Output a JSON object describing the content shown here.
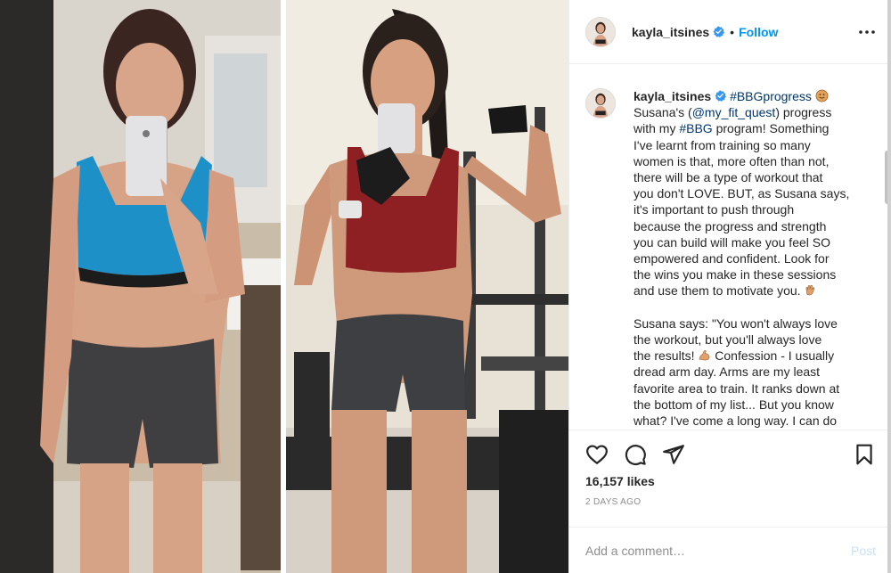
{
  "post": {
    "username": "kayla_itsines",
    "follow_label": "Follow",
    "separator": "•",
    "caption_segments": [
      {
        "kind": "tag",
        "text": "#BBGprogress"
      },
      {
        "kind": "text",
        "text": " "
      },
      {
        "kind": "emoji",
        "text": "🤗"
      },
      {
        "kind": "text",
        "text": "\nSusana's ("
      },
      {
        "kind": "tag",
        "text": "@my_fit_quest"
      },
      {
        "kind": "text",
        "text": ") progress\nwith my "
      },
      {
        "kind": "tag",
        "text": "#BBG"
      },
      {
        "kind": "text",
        "text": " program! Something\nI've learnt from training so many\nwomen is that, more often than not,\nthere will be a type of workout that\nyou don't LOVE. BUT, as Susana says,\nit's important to push through\nbecause the progress and strength\nyou can build will make you feel SO\nempowered and confident. Look for\nthe wins you make in these sessions\nand use them to motivate you. "
      },
      {
        "kind": "emoji",
        "text": "👏"
      },
      {
        "kind": "text",
        "text": "\n\nSusana says: \"You won't always love\nthe workout, but you'll always love\nthe results! "
      },
      {
        "kind": "emoji",
        "text": "💪"
      },
      {
        "kind": "text",
        "text": " Confession - I usually\ndread arm day. Arms are my least\nfavorite area to train. It ranks down at\nthe bottom of my list... But you know\nwhat? I've come a long way. I can do"
      }
    ],
    "likes_text": "16,157 likes",
    "time_text": "2 DAYS AGO",
    "comment_placeholder": "Add a comment…",
    "post_label": "Post"
  },
  "icons": {
    "more": "more-options-icon",
    "like": "heart-icon",
    "comment": "comment-icon",
    "share": "send-icon",
    "save": "bookmark-icon",
    "verified": "verified-badge-icon"
  },
  "colors": {
    "accent": "#0095f6",
    "verified": "#3897f0",
    "muted": "#8e8e8e",
    "divider": "#efefef",
    "text": "#262626",
    "link": "#00376b"
  }
}
